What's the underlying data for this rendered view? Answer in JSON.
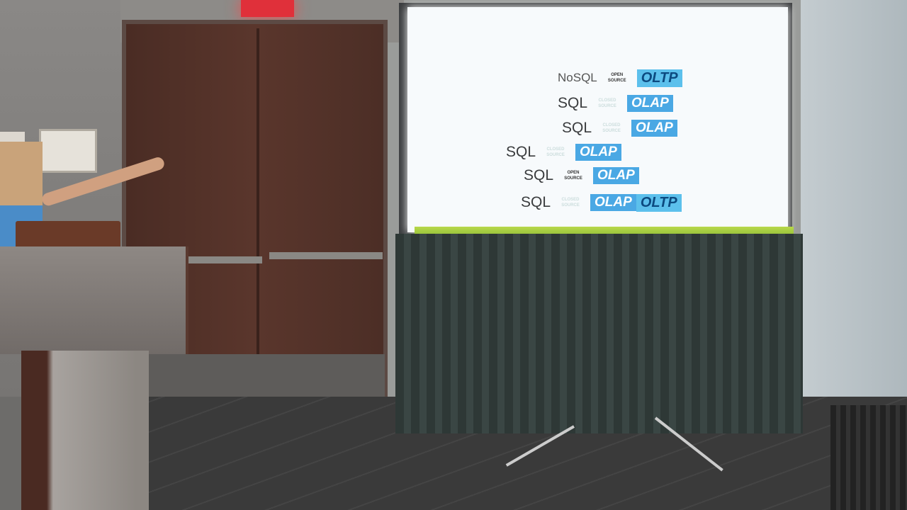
{
  "slide": {
    "rows": [
      {
        "db": "NoSQL",
        "source": "OPEN SOURCE",
        "tags": [
          "OLTP"
        ]
      },
      {
        "db": "SQL",
        "source": "CLOSED SOURCE",
        "tags": [
          "OLAP"
        ]
      },
      {
        "db": "SQL",
        "source": "CLOSED SOURCE",
        "tags": [
          "OLAP"
        ]
      },
      {
        "db": "SQL",
        "source": "CLOSED SOURCE",
        "tags": [
          "OLAP"
        ]
      },
      {
        "db": "SQL",
        "source": "OPEN SOURCE",
        "tags": [
          "OLAP"
        ]
      },
      {
        "db": "SQL",
        "source": "CLOSED SOURCE",
        "tags": [
          "OLAP",
          "OLTP"
        ]
      }
    ]
  },
  "colors": {
    "olap": "#4aa8e4",
    "oltp": "#5cc0ec",
    "exit_sign": "#e0303a"
  }
}
